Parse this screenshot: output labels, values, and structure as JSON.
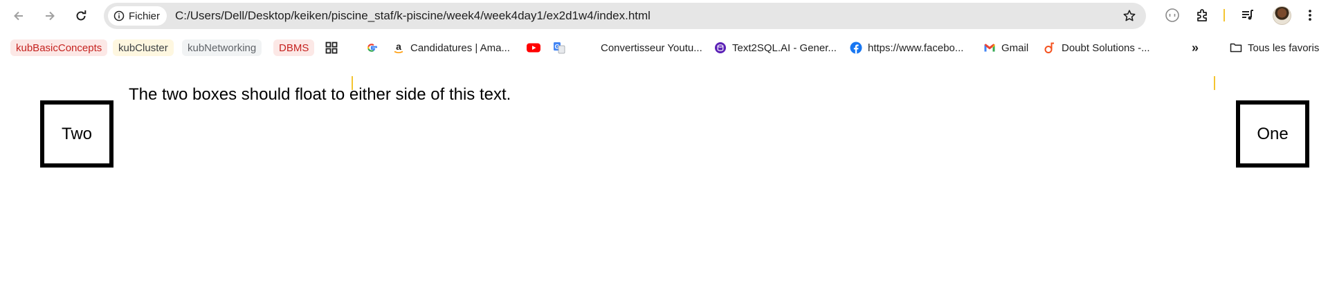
{
  "browser": {
    "site_chip_label": "Fichier",
    "url": "C:/Users/Dell/Desktop/keiken/piscine_staf/k-piscine/week4/week4day1/ex2d1w4/index.html"
  },
  "bookmarks": {
    "items": [
      {
        "label": "kubBasicConcepts",
        "color": "#c5221f",
        "bg": "#fce8e6"
      },
      {
        "label": "kubCluster",
        "color": "#3c4043",
        "bg": "#fef7e0"
      },
      {
        "label": "kubNetworking",
        "color": "#5f6368",
        "bg": "#f1f3f4"
      },
      {
        "label": "DBMS",
        "color": "#c5221f",
        "bg": "#fce8e6"
      },
      {
        "label": "Candidatures | Ama..."
      },
      {
        "label": "Convertisseur Youtu..."
      },
      {
        "label": "Text2SQL.AI - Gener..."
      },
      {
        "label": "https://www.facebo..."
      },
      {
        "label": "Gmail"
      },
      {
        "label": "Doubt Solutions -..."
      }
    ],
    "overflow_label": "»",
    "all_bookmarks_label": "Tous les favoris"
  },
  "page": {
    "paragraph": "The two boxes should float to either side of this text.",
    "box_left_label": "Two",
    "box_right_label": "One"
  }
}
